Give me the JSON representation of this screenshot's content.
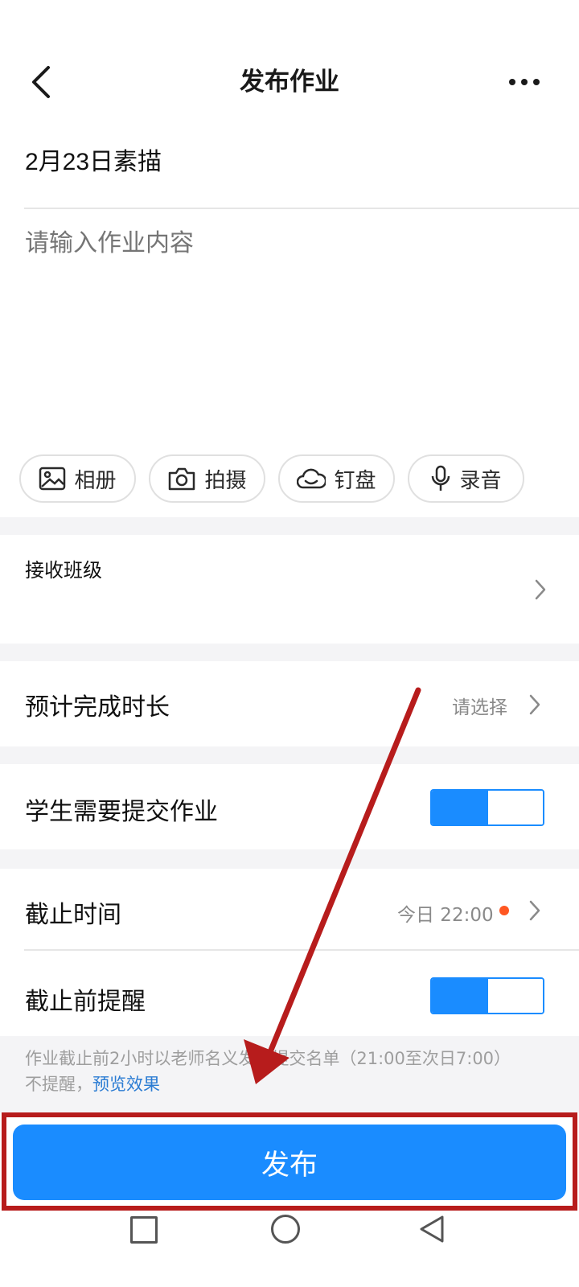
{
  "header": {
    "title": "发布作业"
  },
  "homework": {
    "title_value": "2月23日素描",
    "content_placeholder": "请输入作业内容"
  },
  "attachments": [
    {
      "label": "相册",
      "icon": "image-icon"
    },
    {
      "label": "拍摄",
      "icon": "camera-icon"
    },
    {
      "label": "钉盘",
      "icon": "cloud-drive-icon"
    },
    {
      "label": "录音",
      "icon": "microphone-icon"
    }
  ],
  "settings": {
    "receive_class": {
      "label": "接收班级"
    },
    "duration": {
      "label": "预计完成时长",
      "value": "请选择"
    },
    "need_submit": {
      "label": "学生需要提交作业",
      "enabled": true
    },
    "deadline": {
      "label": "截止时间",
      "value": "今日 22:00"
    },
    "reminder": {
      "label": "截止前提醒",
      "enabled": true
    }
  },
  "hint": {
    "text_line1": "作业截止前2小时以老师名义发布提交名单（21:00至次日7:00）",
    "text_line2_prefix": "不提醒，",
    "link": "预览效果"
  },
  "publish": {
    "label": "发布"
  },
  "colors": {
    "accent": "#1a8cff",
    "highlight": "#b71c1c",
    "dot": "#ff5722"
  }
}
